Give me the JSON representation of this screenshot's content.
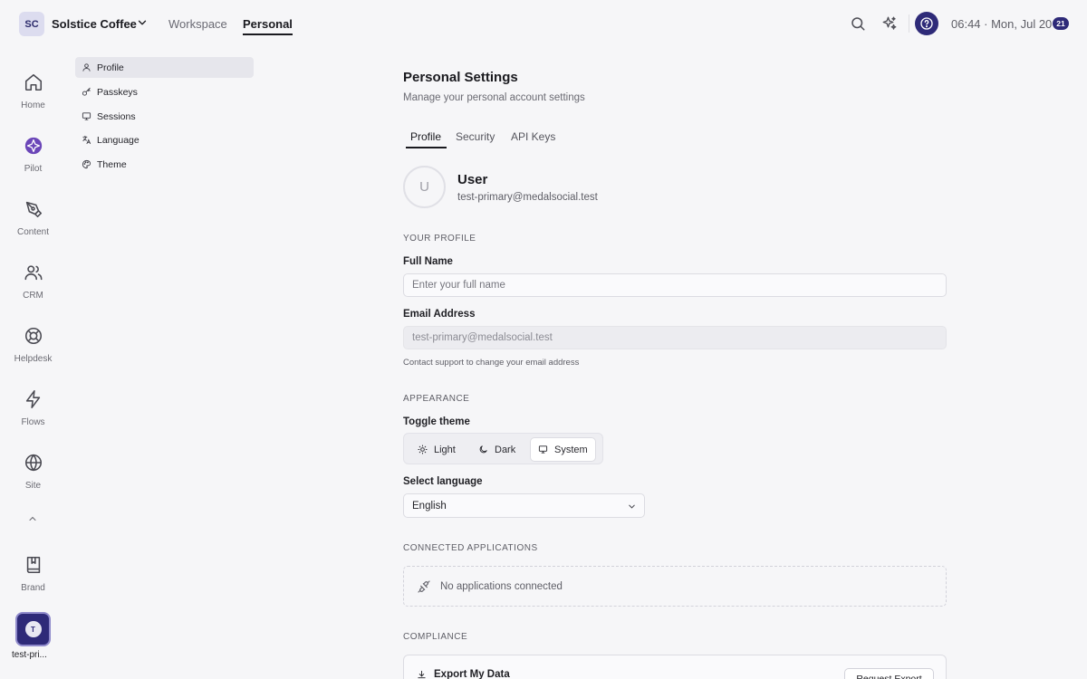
{
  "topbar": {
    "workspace_initials": "SC",
    "workspace_name": "Solstice Coffee",
    "tabs": [
      {
        "label": "Workspace",
        "active": false
      },
      {
        "label": "Personal",
        "active": true
      }
    ],
    "time": "06:44 · Mon, Jul 20",
    "notification_count": "21"
  },
  "rail": {
    "items": [
      {
        "label": "Home",
        "icon": "home-icon"
      },
      {
        "label": "Pilot",
        "icon": "pilot-icon"
      },
      {
        "label": "Content",
        "icon": "pen-tool-icon"
      },
      {
        "label": "CRM",
        "icon": "users-icon"
      },
      {
        "label": "Helpdesk",
        "icon": "lifebuoy-icon"
      },
      {
        "label": "Flows",
        "icon": "zap-icon"
      },
      {
        "label": "Site",
        "icon": "globe-icon"
      },
      {
        "label": "Brand",
        "icon": "book-icon"
      }
    ],
    "user_initial": "T",
    "user_label": "test-pri..."
  },
  "sidebar": {
    "items": [
      {
        "label": "Profile",
        "icon": "user-icon",
        "active": true
      },
      {
        "label": "Passkeys",
        "icon": "key-icon",
        "active": false
      },
      {
        "label": "Sessions",
        "icon": "monitor-icon",
        "active": false
      },
      {
        "label": "Language",
        "icon": "languages-icon",
        "active": false
      },
      {
        "label": "Theme",
        "icon": "palette-icon",
        "active": false
      }
    ]
  },
  "main": {
    "title": "Personal Settings",
    "subtitle": "Manage your personal account settings",
    "tabs": [
      {
        "label": "Profile",
        "active": true
      },
      {
        "label": "Security",
        "active": false
      },
      {
        "label": "API Keys",
        "active": false
      }
    ],
    "user": {
      "avatar_initial": "U",
      "name": "User",
      "email": "test-primary@medalsocial.test"
    },
    "your_profile": {
      "heading": "YOUR PROFILE",
      "full_name_label": "Full Name",
      "full_name_placeholder": "Enter your full name",
      "full_name_value": "",
      "email_label": "Email Address",
      "email_value": "test-primary@medalsocial.test",
      "email_hint": "Contact support to change your email address"
    },
    "appearance": {
      "heading": "APPEARANCE",
      "toggle_label": "Toggle theme",
      "options": [
        {
          "label": "Light",
          "icon": "sun-icon",
          "active": false
        },
        {
          "label": "Dark",
          "icon": "moon-icon",
          "active": false
        },
        {
          "label": "System",
          "icon": "monitor-icon",
          "active": true
        }
      ],
      "language_label": "Select language",
      "language_value": "English"
    },
    "connected": {
      "heading": "CONNECTED APPLICATIONS",
      "empty_text": "No applications connected"
    },
    "compliance": {
      "heading": "COMPLIANCE",
      "export_title": "Export My Data",
      "export_button": "Request Export"
    }
  },
  "colors": {
    "accent": "#2e2a78",
    "background": "#f6f6f8"
  }
}
